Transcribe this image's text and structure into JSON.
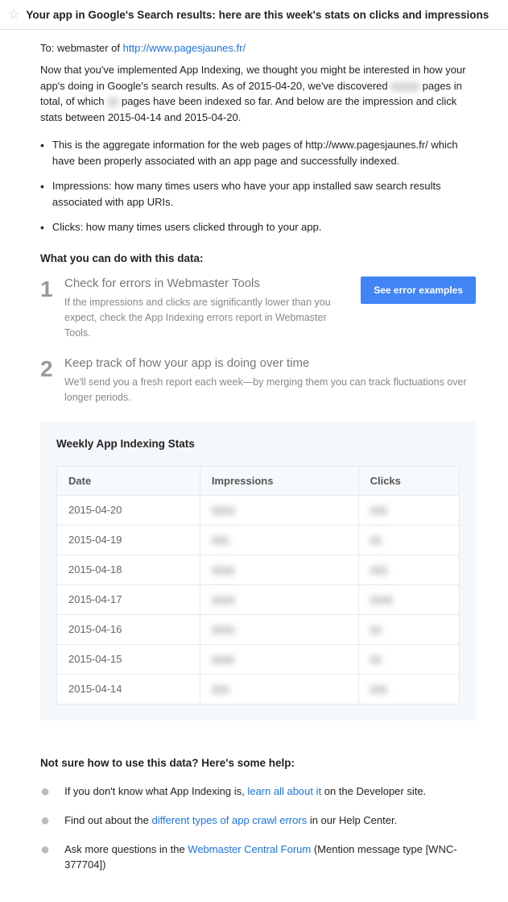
{
  "header": {
    "title": "Your app in Google's Search results: here are this week's stats on clicks and impressions"
  },
  "to": {
    "label": "To: webmaster of ",
    "link": "http://www.pagesjaunes.fr/"
  },
  "intro": {
    "p1a": "Now that you've implemented App Indexing, we thought you might be interested in how your app's doing in Google's search results. As of 2015-04-20, we've discovered ",
    "p1b": " pages in total, of which ",
    "p1c": " pages have been indexed so far. And below are the impression and click stats between 2015-04-14 and 2015-04-20."
  },
  "bullets": [
    "This is the aggregate information for the web pages of http://www.pagesjaunes.fr/ which have been properly associated with an app page and successfully indexed.",
    "Impressions: how many times users who have your app installed saw search results associated with app URIs.",
    "Clicks: how many times users clicked through to your app."
  ],
  "what_header": "What you can do with this data:",
  "steps": [
    {
      "num": "1",
      "title": "Check for errors in Webmaster Tools",
      "text": "If the impressions and clicks are significantly lower than you expect, check the App Indexing errors report in Webmaster Tools.",
      "button": "See error examples"
    },
    {
      "num": "2",
      "title": "Keep track of how your app is doing over time",
      "text": "We'll send you a fresh report each week—by merging them you can track fluctuations over longer periods."
    }
  ],
  "stats": {
    "title": "Weekly App Indexing Stats",
    "headers": [
      "Date",
      "Impressions",
      "Clicks"
    ],
    "rows": [
      {
        "date": "2015-04-20",
        "imp": "▮▮▮▮",
        "clk": "▮▮▮"
      },
      {
        "date": "2015-04-19",
        "imp": "▮▮▮",
        "clk": "▮▮"
      },
      {
        "date": "2015-04-18",
        "imp": "▮▮▮▮",
        "clk": "▮▮▮"
      },
      {
        "date": "2015-04-17",
        "imp": "▮▮▮▮",
        "clk": "▮▮▮▮"
      },
      {
        "date": "2015-04-16",
        "imp": "▮▮▮▮",
        "clk": "▮▮"
      },
      {
        "date": "2015-04-15",
        "imp": "▮▮▮▮",
        "clk": "▮▮"
      },
      {
        "date": "2015-04-14",
        "imp": "▮▮▮",
        "clk": "▮▮▮"
      }
    ]
  },
  "help": {
    "header": "Not sure how to use this data? Here's some help:",
    "items": [
      {
        "pre": "If you don't know what App Indexing is, ",
        "link": "learn all about it",
        "post": " on the Developer site."
      },
      {
        "pre": "Find out about the ",
        "link": "different types of app crawl errors",
        "post": " in our Help Center."
      },
      {
        "pre": "Ask more questions in the ",
        "link": "Webmaster Central Forum",
        "post": " (Mention message type [WNC-377704])"
      }
    ]
  }
}
